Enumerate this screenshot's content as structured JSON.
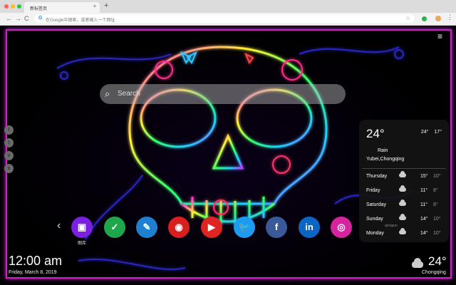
{
  "browser": {
    "tab_title": "新标签页",
    "tab_close": "×",
    "new_tab": "+",
    "omnibox_placeholder": "在Google中搜索，或者输入一个网址",
    "google_glyph": "G",
    "star": "☆",
    "back": "←",
    "forward": "→",
    "reload": "C",
    "menu": "⋮"
  },
  "page": {
    "menu_icon": "≡",
    "search_placeholder": "Search",
    "search_icon": "🔍",
    "accent": "#c526c5"
  },
  "social": [
    "f",
    "t",
    "v",
    "s"
  ],
  "apps": [
    {
      "name": "gallery",
      "glyph": "▣",
      "color": "#7b1fe0",
      "label": "图库"
    },
    {
      "name": "tasks",
      "glyph": "✓",
      "color": "#1fa64a",
      "label": ""
    },
    {
      "name": "notes",
      "glyph": "✎",
      "color": "#1f7fd1",
      "label": ""
    },
    {
      "name": "gamepad",
      "glyph": "◉",
      "color": "#d91e1e",
      "label": ""
    },
    {
      "name": "youtube",
      "glyph": "▶",
      "color": "#e02424",
      "label": ""
    },
    {
      "name": "twitter",
      "glyph": "🐦",
      "color": "#1d9bf0",
      "label": ""
    },
    {
      "name": "facebook",
      "glyph": "f",
      "color": "#3b5998",
      "label": ""
    },
    {
      "name": "linkedin",
      "glyph": "in",
      "color": "#0a66c2",
      "label": ""
    },
    {
      "name": "instagram",
      "glyph": "◎",
      "color": "#d6249f",
      "label": ""
    }
  ],
  "nav_arrows": {
    "prev": "‹",
    "next": "›"
  },
  "weather": {
    "temp": "24°",
    "high": "24°",
    "low": "17°",
    "condition": "Rain",
    "location": "Yubei,Chongqing",
    "forecast": [
      {
        "day": "Thursday",
        "high": "15°",
        "low": "10°"
      },
      {
        "day": "Friday",
        "high": "11°",
        "low": "8°"
      },
      {
        "day": "Saturday",
        "high": "11°",
        "low": "8°"
      },
      {
        "day": "Sunday",
        "high": "14°",
        "low": "10°"
      },
      {
        "day": "Monday",
        "high": "14°",
        "low": "10°"
      }
    ],
    "provider": "amazon"
  },
  "clock": {
    "time": "12:00 am",
    "date": "Friday, March 8, 2019"
  },
  "bottom_weather": {
    "temp": "24°",
    "city": "Chongqing"
  }
}
